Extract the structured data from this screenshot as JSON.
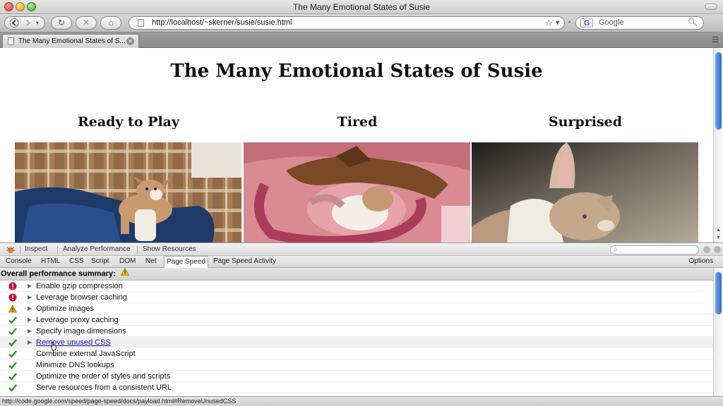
{
  "window": {
    "title": "The Many Emotional States of Susie"
  },
  "toolbar": {
    "back_icon": "back-arrow",
    "forward_icon": "forward-arrow",
    "url": "http://localhost/~skerner/susie/susie.html",
    "search_placeholder": "Google"
  },
  "tabs": [
    {
      "label": "The Many Emotional States of S..."
    }
  ],
  "page": {
    "title": "The Many Emotional States of Susie",
    "columns": [
      {
        "heading": "Ready to Play"
      },
      {
        "heading": "Tired"
      },
      {
        "heading": "Surprised"
      }
    ]
  },
  "firebug": {
    "top_menu": [
      "Inspect",
      "Analyze Performance",
      "Show Resources"
    ],
    "tabs": [
      "Console",
      "HTML",
      "CSS",
      "Script",
      "DOM",
      "Net",
      "Page Speed",
      "Page Speed Activity"
    ],
    "active_tab": "Page Speed",
    "options_label": "Options",
    "summary_label": "Overall performance summary:",
    "rules": [
      {
        "label": "Enable gzip compression",
        "status": "error",
        "expandable": true
      },
      {
        "label": "Leverage browser caching",
        "status": "error",
        "expandable": true
      },
      {
        "label": "Optimize images",
        "status": "warning",
        "expandable": true
      },
      {
        "label": "Leverage proxy caching",
        "status": "pass",
        "expandable": true
      },
      {
        "label": "Specify image dimensions",
        "status": "pass",
        "expandable": true
      },
      {
        "label": "Remove unused CSS",
        "status": "pass",
        "expandable": true
      },
      {
        "label": "Combine external JavaScript",
        "status": "pass",
        "expandable": false
      },
      {
        "label": "Minimize DNS lookups",
        "status": "pass",
        "expandable": false
      },
      {
        "label": "Optimize the order of styles and scripts",
        "status": "pass",
        "expandable": false
      },
      {
        "label": "Serve resources from a consistent URL",
        "status": "pass",
        "expandable": false
      }
    ]
  },
  "status_bar": {
    "text": "http://code.google.com/speed/page-speed/docs/payload.html#RemoveUnusedCSS"
  },
  "colors": {
    "error": "#c8102e",
    "warning": "#e0a800",
    "pass": "#3a8a2a",
    "link": "#1a0dab",
    "scroll_thumb": "#2c6cc9"
  }
}
